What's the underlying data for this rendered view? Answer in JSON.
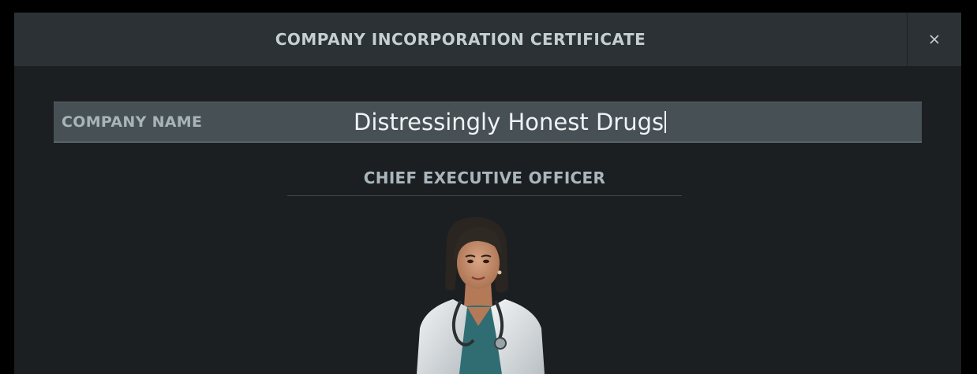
{
  "dialog": {
    "title": "COMPANY INCORPORATION CERTIFICATE",
    "close_icon": "close-icon"
  },
  "company": {
    "label": "COMPANY NAME",
    "value": "Distressingly Honest Drugs"
  },
  "ceo": {
    "heading": "CHIEF EXECUTIVE OFFICER",
    "portrait_icon": "doctor-portrait"
  }
}
